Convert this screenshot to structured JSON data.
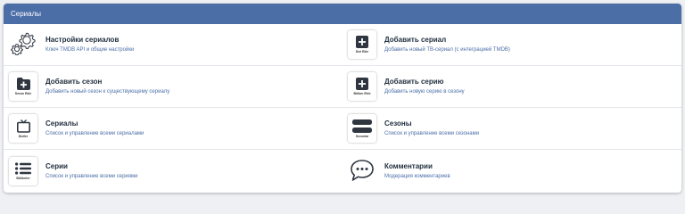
{
  "header": {
    "title": "Сериалы"
  },
  "colors": {
    "header_bg": "#4b6ea7",
    "description": "#4b6ea7",
    "icon": "#2f3640"
  },
  "items": [
    {
      "icon": "gears-icon",
      "caption": "",
      "title": "Настройки сериалов",
      "desc": "Ключ TMDB API и общие настройки"
    },
    {
      "icon": "plus-square-icon",
      "caption": "Dizi Ekle",
      "title": "Добавить сериал",
      "desc": "Добавить новый ТВ-сериал (с интеграцией TMDB)"
    },
    {
      "icon": "folder-plus-icon",
      "caption": "Sezon Ekle",
      "title": "Добавить сезон",
      "desc": "Добавить новый сезон к существующему сериалу"
    },
    {
      "icon": "plus-square-icon",
      "caption": "Bölüm Ekle",
      "title": "Добавить серию",
      "desc": "Добавить новую серию в сезону"
    },
    {
      "icon": "tv-icon",
      "caption": "Diziler",
      "title": "Сериалы",
      "desc": "Список и управление всеми сериалами"
    },
    {
      "icon": "seasons-bars-icon",
      "caption": "Sezonlar",
      "title": "Сезоны",
      "desc": "Список и управление всеми сезонами"
    },
    {
      "icon": "list-icon",
      "caption": "Bölümler",
      "title": "Серии",
      "desc": "Список и управление всеми сериями"
    },
    {
      "icon": "comment-dots-icon",
      "caption": "",
      "title": "Комментарии",
      "desc": "Модерация комментариев"
    }
  ]
}
